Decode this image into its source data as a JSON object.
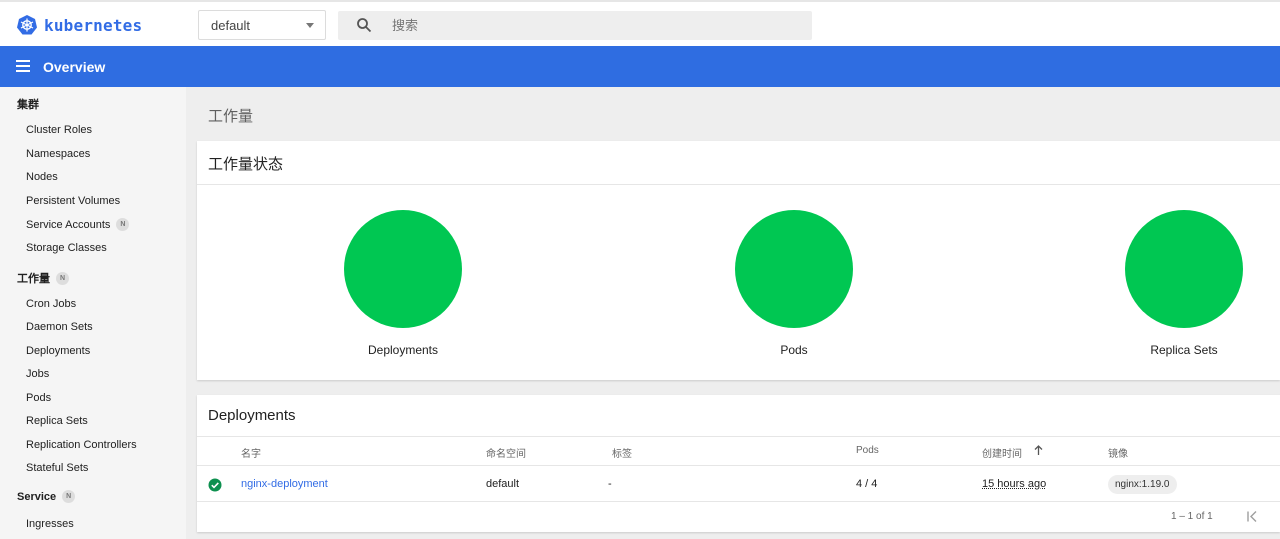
{
  "brand": {
    "name": "kubernetes",
    "color": "#326ce5",
    "icon": "kubernetes-helm-icon"
  },
  "namespace": {
    "selected": "default"
  },
  "search": {
    "placeholder": "搜索",
    "icon": "search-icon"
  },
  "header": {
    "title": "Overview",
    "color": "#2f6de1"
  },
  "sidebar": {
    "sections": [
      {
        "label": "集群",
        "badge": "",
        "items": [
          "Cluster Roles",
          "Namespaces",
          "Nodes",
          "Persistent Volumes",
          "Service Accounts",
          "Storage Classes"
        ]
      },
      {
        "label": "工作量",
        "badge": "N",
        "items": [
          "Cron Jobs",
          "Daemon Sets",
          "Deployments",
          "Jobs",
          "Pods",
          "Replica Sets",
          "Replication Controllers",
          "Stateful Sets"
        ]
      },
      {
        "label": "Service",
        "badge": "N",
        "items": [
          "Ingresses"
        ]
      }
    ],
    "service_accounts_badge": "N"
  },
  "main": {
    "page_title": "工作量",
    "status_card": {
      "title": "工作量状态",
      "color": "#00c752",
      "charts": [
        {
          "label": "Deployments",
          "running_fraction": 1.0
        },
        {
          "label": "Pods",
          "running_fraction": 1.0
        },
        {
          "label": "Replica Sets",
          "running_fraction": 1.0
        }
      ]
    },
    "deployments_card": {
      "title": "Deployments",
      "columns": {
        "name": "名字",
        "namespace": "命名空间",
        "labels": "标签",
        "pods": "Pods",
        "created": "创建时间",
        "images": "镜像"
      },
      "rows": [
        {
          "status": "running-check-icon",
          "name": "nginx-deployment",
          "namespace": "default",
          "labels": "-",
          "pods": "4 / 4",
          "created": "15 hours ago",
          "image": "nginx:1.19.0"
        }
      ],
      "pagination": "1 – 1 of 1"
    }
  }
}
